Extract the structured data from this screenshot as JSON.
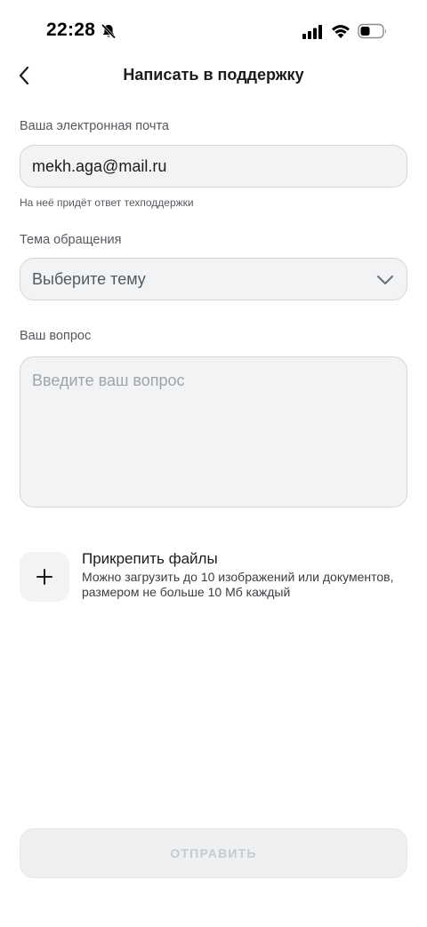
{
  "status_bar": {
    "time": "22:28"
  },
  "header": {
    "title": "Написать в поддержку"
  },
  "form": {
    "email": {
      "label": "Ваша электронная почта",
      "value": "mekh.aga@mail.ru",
      "hint": "На неё придёт ответ техподдержки"
    },
    "topic": {
      "label": "Тема обращения",
      "placeholder": "Выберите тему"
    },
    "question": {
      "label": "Ваш вопрос",
      "placeholder": "Введите ваш вопрос"
    },
    "attach": {
      "title": "Прикрепить файлы",
      "description": "Можно загрузить до 10 изображений или документов, размером не больше 10 Мб каждый"
    },
    "submit_label": "ОТПРАВИТЬ"
  },
  "colors": {
    "field_background": "#f2f3f5",
    "field_border": "#d4d6da",
    "disabled_text": "#c6c9ce"
  }
}
